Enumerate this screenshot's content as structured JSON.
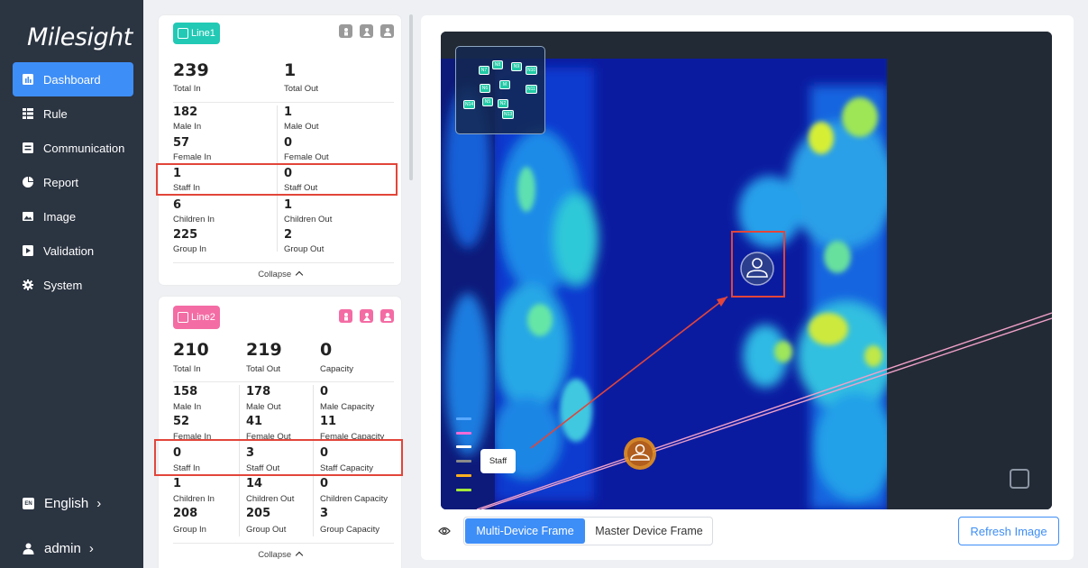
{
  "brand": "Milesight",
  "sidebar": {
    "items": [
      {
        "label": "Dashboard",
        "icon": "bar-chart-icon",
        "active": true
      },
      {
        "label": "Rule",
        "icon": "rule-icon"
      },
      {
        "label": "Communication",
        "icon": "communication-icon"
      },
      {
        "label": "Report",
        "icon": "pie-chart-icon"
      },
      {
        "label": "Image",
        "icon": "image-icon"
      },
      {
        "label": "Validation",
        "icon": "validation-icon"
      },
      {
        "label": "System",
        "icon": "gear-icon"
      }
    ],
    "language_badge": "EN",
    "language": "English",
    "user": "admin",
    "chevron": "›"
  },
  "line1": {
    "name": "Line1",
    "color": "#22c9b5",
    "total_in": "239",
    "total_in_label": "Total In",
    "total_out": "1",
    "total_out_label": "Total Out",
    "male_in": "182",
    "male_in_label": "Male In",
    "male_out": "1",
    "male_out_label": "Male Out",
    "female_in": "57",
    "female_in_label": "Female In",
    "female_out": "0",
    "female_out_label": "Female Out",
    "staff_in": "1",
    "staff_in_label": "Staff In",
    "staff_out": "0",
    "staff_out_label": "Staff Out",
    "children_in": "6",
    "children_in_label": "Children In",
    "children_out": "1",
    "children_out_label": "Children Out",
    "group_in": "225",
    "group_in_label": "Group In",
    "group_out": "2",
    "group_out_label": "Group Out",
    "collapse": "Collapse"
  },
  "line2": {
    "name": "Line2",
    "color": "#f46ca4",
    "total_in": "210",
    "total_in_label": "Total In",
    "total_out": "219",
    "total_out_label": "Total Out",
    "capacity": "0",
    "capacity_label": "Capacity",
    "male_in": "158",
    "male_in_label": "Male In",
    "male_out": "178",
    "male_out_label": "Male Out",
    "male_capacity": "0",
    "male_capacity_label": "Male Capacity",
    "female_in": "52",
    "female_in_label": "Female In",
    "female_out": "41",
    "female_out_label": "Female Out",
    "female_capacity": "11",
    "female_capacity_label": "Female Capacity",
    "staff_in": "0",
    "staff_in_label": "Staff In",
    "staff_out": "3",
    "staff_out_label": "Staff Out",
    "staff_capacity": "0",
    "staff_capacity_label": "Staff Capacity",
    "children_in": "1",
    "children_in_label": "Children In",
    "children_out": "14",
    "children_out_label": "Children Out",
    "children_capacity": "0",
    "children_capacity_label": "Children Capacity",
    "group_in": "208",
    "group_in_label": "Group In",
    "group_out": "205",
    "group_out_label": "Group Out",
    "group_capacity": "3",
    "group_capacity_label": "Group Capacity",
    "collapse": "Collapse"
  },
  "viewer": {
    "nodes": [
      "N7",
      "N8",
      "N9",
      "N10",
      "N6",
      "M",
      "N11",
      "N14",
      "N5",
      "N2",
      "N13"
    ],
    "legend_colors": [
      "#5aa9ff",
      "#f06bd8",
      "#ffffff",
      "#8a8a8a",
      "#ffb020",
      "#a4e83a"
    ],
    "staff_tag": "Staff",
    "frame_tabs": [
      "Multi-Device Frame",
      "Master Device Frame"
    ],
    "refresh": "Refresh Image"
  }
}
